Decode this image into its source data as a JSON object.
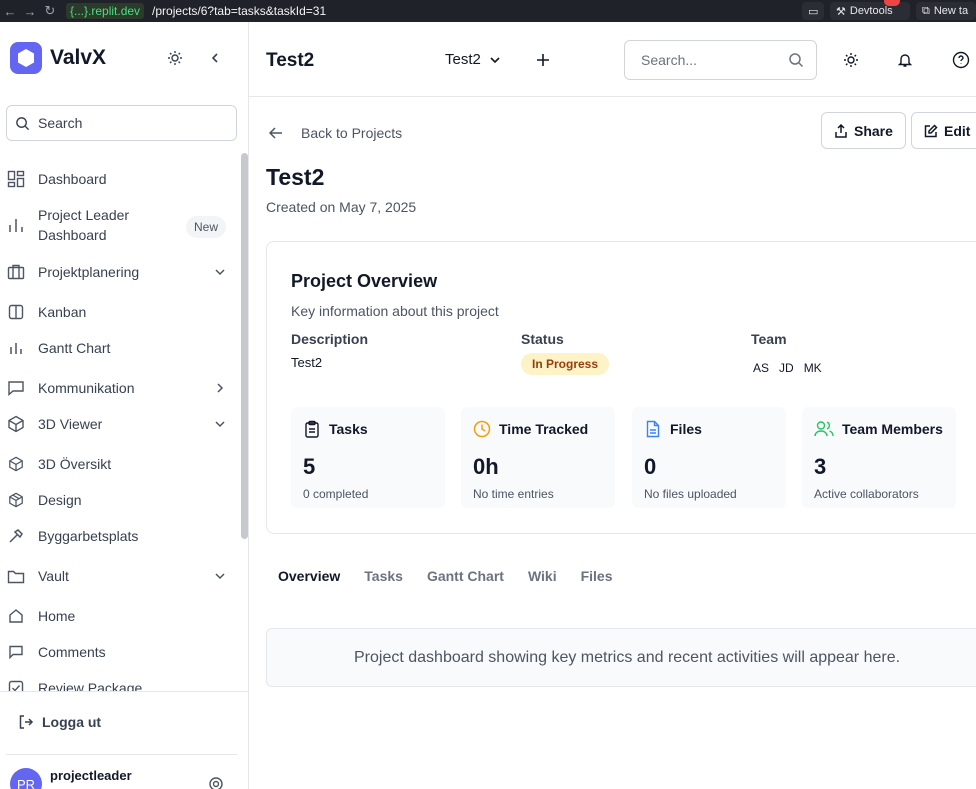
{
  "browser": {
    "url_domain": "{...}.replit.dev",
    "url_path": "/projects/6?tab=tasks&taskId=31",
    "devtools_label": "Devtools",
    "new_tab_label": "New ta"
  },
  "sidebar": {
    "brand": "ValvX",
    "search_placeholder": "Search",
    "new_badge": "New",
    "items": [
      {
        "label": "Dashboard",
        "icon": "dashboard-icon"
      },
      {
        "label": "Project Leader Dashboard",
        "icon": "bar-chart-icon"
      },
      {
        "label": "Projektplanering",
        "icon": "briefcase-icon"
      },
      {
        "label": "Kanban",
        "icon": "kanban-icon"
      },
      {
        "label": "Gantt Chart",
        "icon": "gantt-icon"
      },
      {
        "label": "Kommunikation",
        "icon": "message-icon"
      },
      {
        "label": "3D Viewer",
        "icon": "cube-icon"
      },
      {
        "label": "3D Översikt",
        "icon": "cube-small-icon"
      },
      {
        "label": "Design",
        "icon": "package-icon"
      },
      {
        "label": "Byggarbetsplats",
        "icon": "hammer-icon"
      },
      {
        "label": "Vault",
        "icon": "folder-icon"
      },
      {
        "label": "Home",
        "icon": "home-icon"
      },
      {
        "label": "Comments",
        "icon": "comment-icon"
      },
      {
        "label": "Review Package",
        "icon": "check-square-icon"
      }
    ],
    "logout": "Logga ut",
    "user_initials": "PR",
    "user_name": "projectleader"
  },
  "header": {
    "title": "Test2",
    "project_select": "Test2",
    "search_placeholder": "Search..."
  },
  "main": {
    "back_label": "Back to Projects",
    "share_label": "Share",
    "edit_label": "Edit",
    "project_title": "Test2",
    "created": "Created on May 7, 2025",
    "overview": {
      "title": "Project Overview",
      "subtitle": "Key information about this project",
      "description_label": "Description",
      "description_value": "Test2",
      "status_label": "Status",
      "status_value": "In Progress",
      "team_label": "Team",
      "team": [
        "AS",
        "JD",
        "MK"
      ]
    },
    "stats": [
      {
        "title": "Tasks",
        "value": "5",
        "sub": "0 completed",
        "icon": "clipboard-icon",
        "color": "#111827"
      },
      {
        "title": "Time Tracked",
        "value": "0h",
        "sub": "No time entries",
        "icon": "clock-icon",
        "color": "#f59e0b"
      },
      {
        "title": "Files",
        "value": "0",
        "sub": "No files uploaded",
        "icon": "file-icon",
        "color": "#3b82f6"
      },
      {
        "title": "Team Members",
        "value": "3",
        "sub": "Active collaborators",
        "icon": "users-icon",
        "color": "#22c55e"
      }
    ],
    "tabs": [
      "Overview",
      "Tasks",
      "Gantt Chart",
      "Wiki",
      "Files"
    ],
    "active_tab": "Overview",
    "info_text": "Project dashboard showing key metrics and recent activities will appear here."
  },
  "colors": {
    "brand": "#6366f1",
    "status_bg": "#fef3c7",
    "status_text": "#92400e"
  }
}
